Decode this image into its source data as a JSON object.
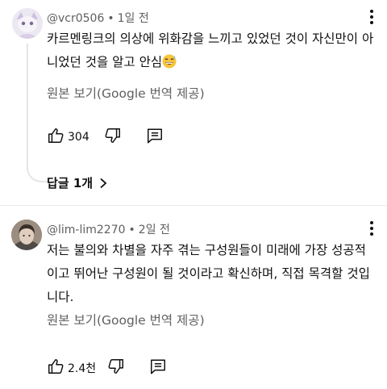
{
  "comments": [
    {
      "author": "@vcr0506",
      "time": "1일 전",
      "text": "카르멘링크의 의상에 위화감을 느끼고 있었던 것이 자신만이 아니었던 것을 알고 안심",
      "emoji_icon": "grinning-sweat-emoji-icon",
      "translate_label": "원본 보기(Google 번역 제공)",
      "likes": "304",
      "replies_label": "답글 1개"
    },
    {
      "author": "@lim-lim2270",
      "time": "2일 전",
      "text": "저는 불의와 차별을 자주 겪는 구성원들이 미래에 가장 성공적이고 뛰어난 구성원이 될 것이라고 확신하며, 직접 목격할 것입니다.",
      "translate_label": "원본 보기(Google 번역 제공)",
      "likes": "2.4천"
    }
  ],
  "meta_separator": "•",
  "icons": [
    "thumb-up-icon",
    "thumb-down-icon",
    "reply-icon",
    "more-vert-icon",
    "chevron-right-icon",
    "avatar"
  ]
}
